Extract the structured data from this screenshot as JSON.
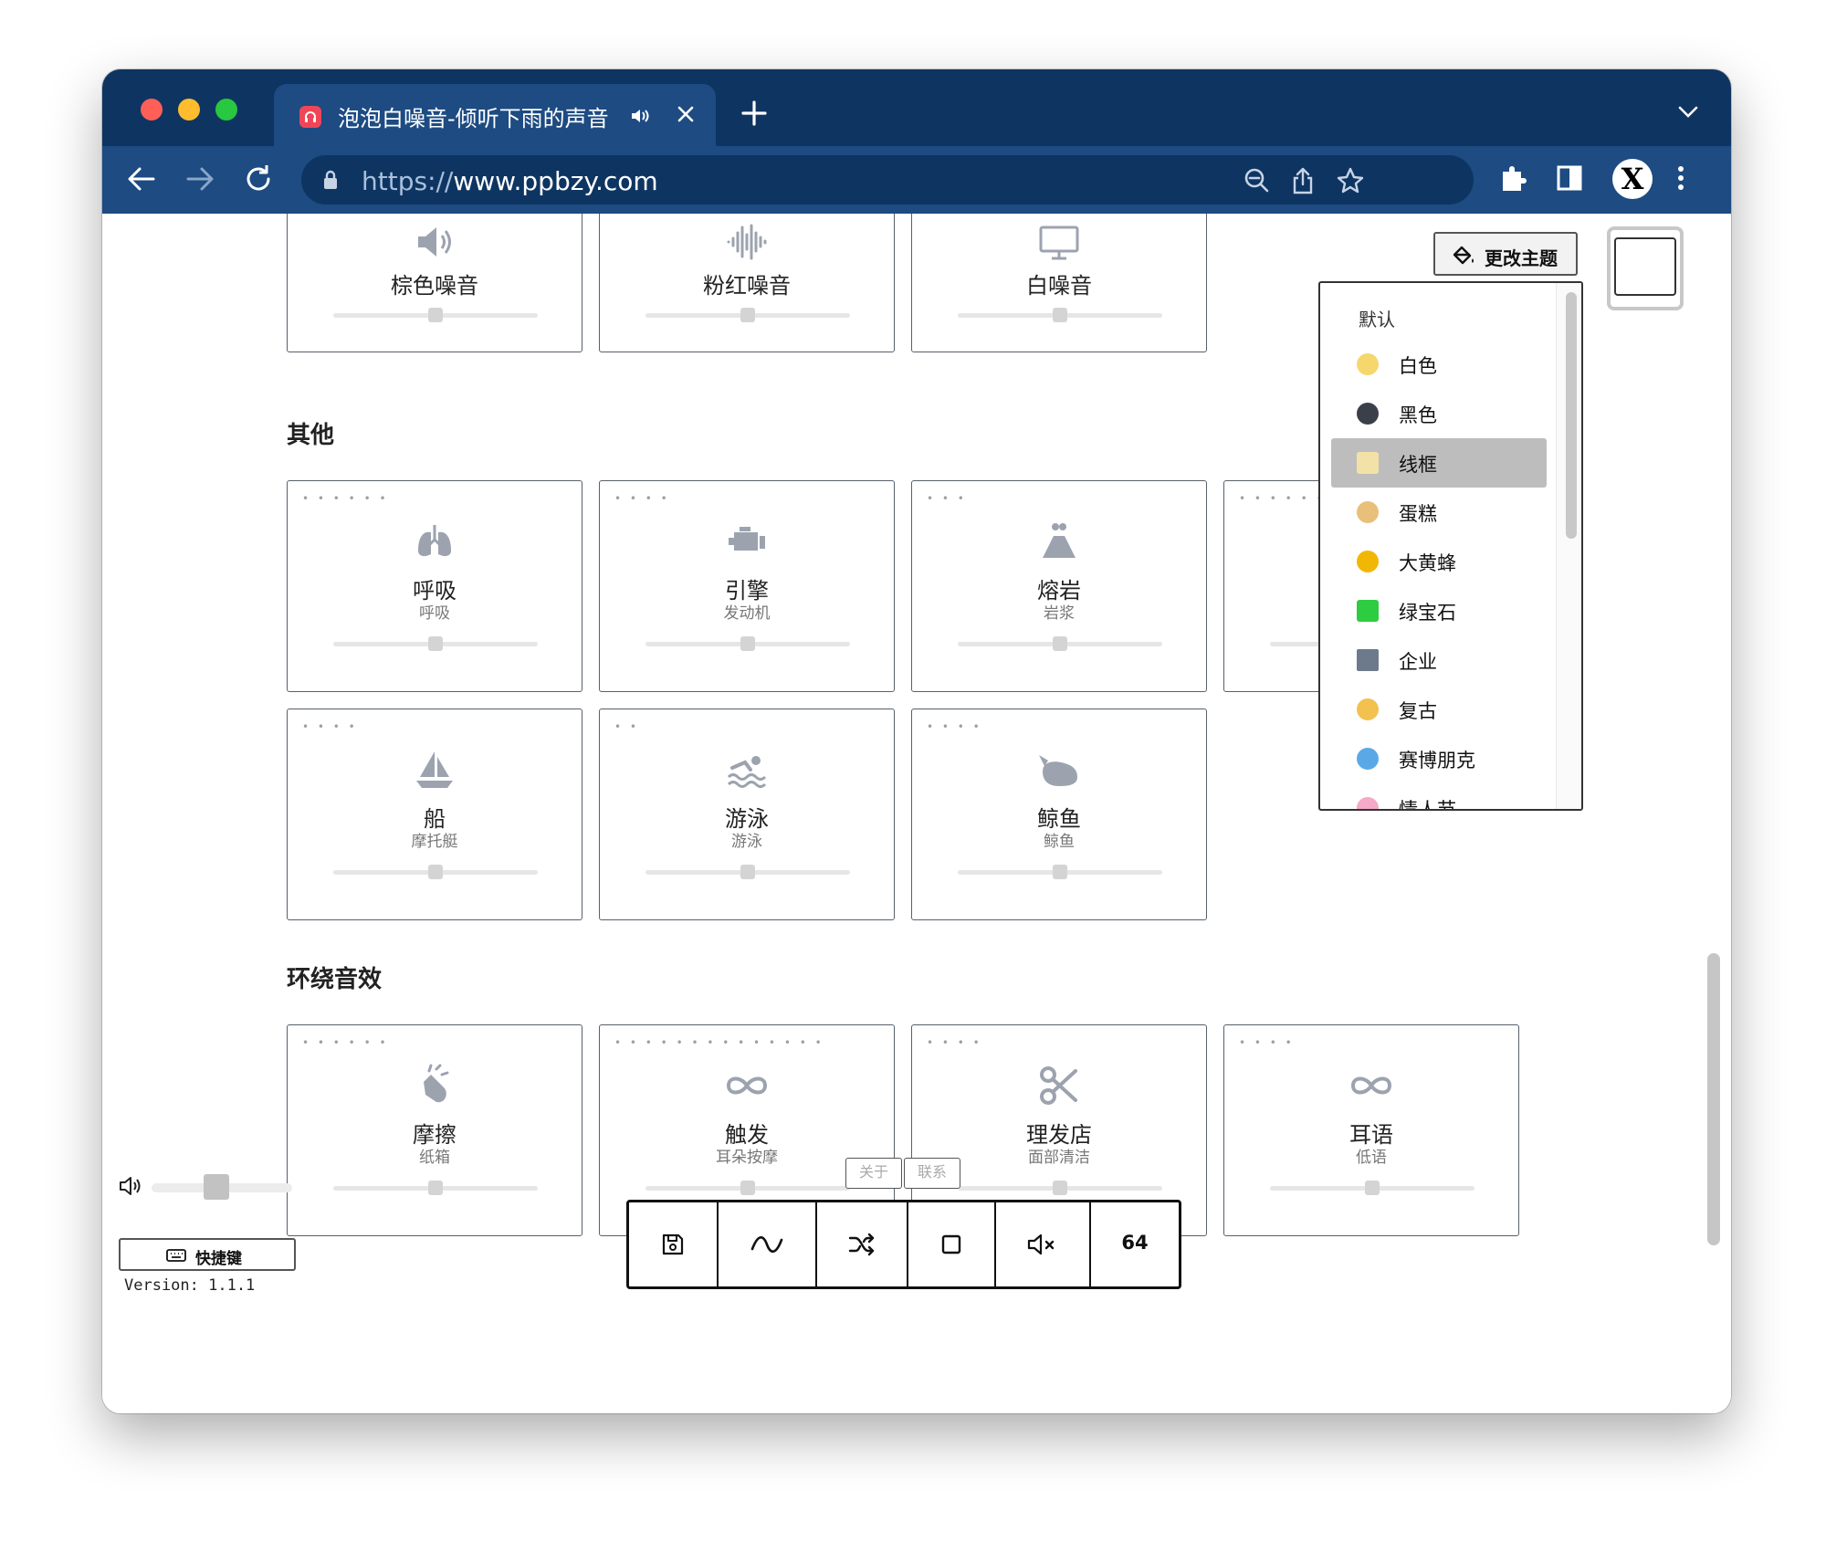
{
  "browser": {
    "tab_title": "泡泡白噪音-倾听下雨的声音",
    "url_scheme": "https://",
    "url_host": "www.ppbzy.com",
    "profile_initial": "X"
  },
  "theme_button": {
    "label": "更改主题",
    "icon": "paint-bucket-icon"
  },
  "theme_menu": {
    "header": "默认",
    "items": [
      {
        "label": "白色",
        "emoji_color": "#f5d76e"
      },
      {
        "label": "黑色",
        "emoji_color": "#3a3f4a"
      },
      {
        "label": "线框",
        "emoji_color": "#f3e2a8",
        "selected": true
      },
      {
        "label": "蛋糕",
        "emoji_color": "#e8c07a"
      },
      {
        "label": "大黄蜂",
        "emoji_color": "#f2b705"
      },
      {
        "label": "绿宝石",
        "emoji_color": "#2ecc40"
      },
      {
        "label": "企业",
        "emoji_color": "#6d7a8c"
      },
      {
        "label": "复古",
        "emoji_color": "#f2c14e"
      },
      {
        "label": "赛博朋克",
        "emoji_color": "#5aa9e6"
      },
      {
        "label": "情人节",
        "emoji_color": "#f5a8c8"
      }
    ]
  },
  "noise_cards": [
    {
      "title": "棕色噪音",
      "icon": "speaker-icon"
    },
    {
      "title": "粉红噪音",
      "icon": "waveform-icon"
    },
    {
      "title": "白噪音",
      "icon": "monitor-icon"
    }
  ],
  "sections": {
    "other": "其他",
    "ambient": "环绕音效"
  },
  "other_cards": [
    {
      "title": "呼吸",
      "subtitle": "呼吸",
      "dots": "• • • • • •",
      "icon": "lungs-icon"
    },
    {
      "title": "引擎",
      "subtitle": "发动机",
      "dots": "• • • •",
      "icon": "engine-icon"
    },
    {
      "title": "熔岩",
      "subtitle": "岩浆",
      "dots": "• • •",
      "icon": "volcano-icon"
    },
    {
      "title": "",
      "subtitle": "",
      "dots": "• • • • • • •",
      "icon": ""
    },
    {
      "title": "船",
      "subtitle": "摩托艇",
      "dots": "• • • •",
      "icon": "sailboat-icon"
    },
    {
      "title": "游泳",
      "subtitle": "游泳",
      "dots": "• •",
      "icon": "swimmer-icon"
    },
    {
      "title": "鲸鱼",
      "subtitle": "鲸鱼",
      "dots": "• • • •",
      "icon": "whale-icon"
    }
  ],
  "ambient_cards": [
    {
      "title": "摩擦",
      "subtitle": "纸箱",
      "dots": "• • • • • •",
      "icon": "hands-clapping-icon"
    },
    {
      "title": "触发",
      "subtitle": "耳朵按摩",
      "dots": "• • • • • • • • • • • • • •",
      "icon": "infinity-icon"
    },
    {
      "title": "理发店",
      "subtitle": "面部清洁",
      "dots": "• • • •",
      "icon": "scissors-icon"
    },
    {
      "title": "耳语",
      "subtitle": "低语",
      "dots": "• • • •",
      "icon": "infinity-icon"
    }
  ],
  "footer": {
    "about": "关于",
    "contact": "联系",
    "shortcuts": "快捷键",
    "version": "Version: 1.1.1",
    "volume_level": 0.45
  },
  "control_bar": {
    "timer_label": "64",
    "buttons": [
      "save-icon",
      "wave-icon",
      "shuffle-icon",
      "stop-icon",
      "mute-icon",
      "timer"
    ]
  }
}
